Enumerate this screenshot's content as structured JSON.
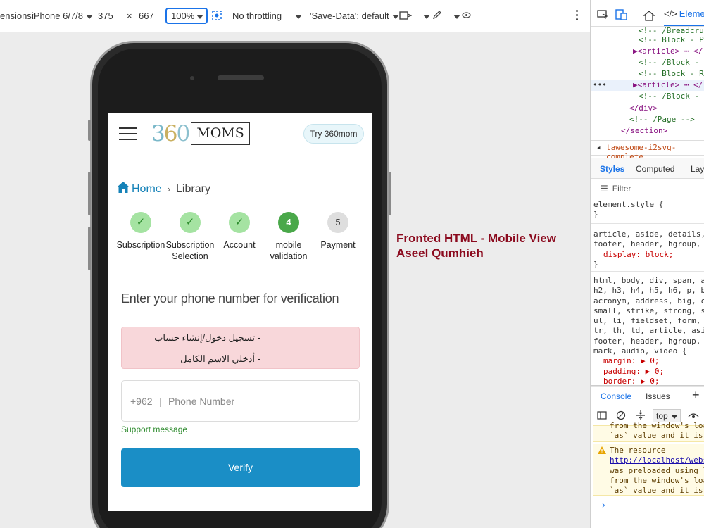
{
  "toolbar": {
    "dimensions_label": "ensions:",
    "device": "iPhone 6/7/8",
    "width": "375",
    "times": "×",
    "height": "667",
    "zoom": "100%",
    "throttling": "No throttling",
    "save_data": "'Save-Data': default"
  },
  "app": {
    "try_button": "Try 360mom",
    "logo_digits": [
      "3",
      "6",
      "0"
    ],
    "logo_word": "MOMS",
    "breadcrumb": {
      "home": "Home",
      "separator": "›",
      "current": "Library"
    },
    "steps": [
      {
        "label": "Subscription",
        "state": "done",
        "mark": "✓"
      },
      {
        "label": "Subscription Selection",
        "state": "done",
        "mark": "✓"
      },
      {
        "label": "Account",
        "state": "done",
        "mark": "✓"
      },
      {
        "label": "mobile validation",
        "state": "active",
        "mark": "4"
      },
      {
        "label": "Payment",
        "state": "pending",
        "mark": "5"
      }
    ],
    "heading": "Enter your phone number for verification",
    "alert_lines": [
      "- تسجيل دخول/إنشاء حساب",
      "- أدخلي الاسم الكامل"
    ],
    "country_code": "+962",
    "code_separator": "|",
    "phone_placeholder": "Phone Number",
    "support_message": "Support message",
    "verify_label": "Verify"
  },
  "caption": {
    "line1": "Fronted HTML - Mobile View",
    "line2": "Aseel Qumhieh"
  },
  "devtools": {
    "elements_tab": "Eleme",
    "code_lines": [
      "<!-- /Breadcrum",
      "<!-- Block - Pr",
      "<article> ⋯ </",
      "<!-- /Block - B",
      "<!-- Block - Re",
      "<article> ⋯ </",
      "<!-- /Block - B",
      "</div>",
      "<!-- /Page -->",
      "</section>"
    ],
    "crumb": "tawesome-i2svg-complete",
    "tabs": {
      "styles": "Styles",
      "computed": "Computed",
      "layout": "Layo"
    },
    "filter": "Filter",
    "style_blocks": [
      [
        "element.style {",
        "}"
      ],
      [
        "article, aside, details, f",
        "footer, header, hgroup, m",
        "  display: block;",
        "}"
      ],
      [
        "html, body, div, span, ap",
        "h2, h3, h4, h5, h6, p, bl",
        "acronym, address, big, ci",
        "small, strike, strong, su",
        "ul, li, fieldset, form, la",
        "tr, th, td, article, asid",
        "footer, header, hgroup, m",
        "mark, audio, video {",
        "  margin: ▶ 0;",
        "  padding: ▶ 0;",
        "  border: ▶ 0;"
      ]
    ],
    "console_tabs": {
      "console": "Console",
      "issues": "Issues",
      "plus": "+"
    },
    "console_context": "top",
    "warning1": [
      "from the window's loa",
      "`as` value and it is"
    ],
    "warning2": [
      "The resource",
      "http://localhost/webs",
      "was preloaded using l",
      "from the window's loa",
      "`as` value and it is"
    ],
    "prompt": "›"
  }
}
